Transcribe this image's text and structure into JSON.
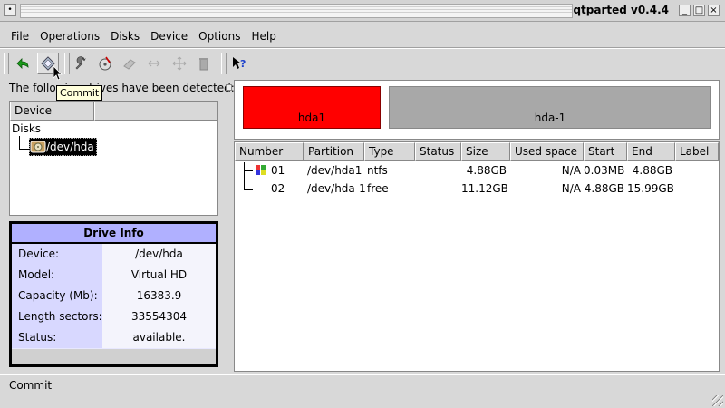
{
  "window": {
    "title": "qtparted v0.4.4",
    "left_button": "•",
    "minimize": "_",
    "maximize": "□",
    "close": "×"
  },
  "menu": [
    {
      "label": "File"
    },
    {
      "label": "Operations"
    },
    {
      "label": "Disks"
    },
    {
      "label": "Device"
    },
    {
      "label": "Options"
    },
    {
      "label": "Help"
    }
  ],
  "toolbar": {
    "tooltip": "Commit",
    "buttons": [
      "undo-icon",
      "commit-icon",
      "properties-icon",
      "check-icon",
      "eraser-icon",
      "resize-icon",
      "move-icon",
      "delete-icon",
      "whats-this-icon"
    ]
  },
  "left_panel": {
    "detected_label": "The following drives have been detected:",
    "tree_header": [
      "Device",
      ""
    ],
    "tree_root": "Disks",
    "tree_item": "/dev/hda"
  },
  "drive_info": {
    "title": "Drive Info",
    "rows": [
      {
        "key": "Device:",
        "value": "/dev/hda"
      },
      {
        "key": "Model:",
        "value": "Virtual HD"
      },
      {
        "key": "Capacity (Mb):",
        "value": "16383.9"
      },
      {
        "key": "Length sectors:",
        "value": "33554304"
      },
      {
        "key": "Status:",
        "value": "available."
      }
    ]
  },
  "disk_map": {
    "partitions": [
      {
        "label": "hda1",
        "color": "#ff0000"
      },
      {
        "label": "hda-1",
        "color": "#a8a8a8"
      }
    ]
  },
  "partition_table": {
    "headers": [
      "Number",
      "Partition",
      "Type",
      "Status",
      "Size",
      "Used space",
      "Start",
      "End",
      "Label"
    ],
    "rows": [
      {
        "number": "01",
        "partition": "/dev/hda1",
        "type": "ntfs",
        "status": "",
        "size": "4.88GB",
        "used": "N/A",
        "start": "0.03MB",
        "end": "4.88GB",
        "label": ""
      },
      {
        "number": "02",
        "partition": "/dev/hda-1",
        "type": "free",
        "status": "",
        "size": "11.12GB",
        "used": "N/A",
        "start": "4.88GB",
        "end": "15.99GB",
        "label": ""
      }
    ]
  },
  "status_bar": {
    "text": "Commit"
  }
}
